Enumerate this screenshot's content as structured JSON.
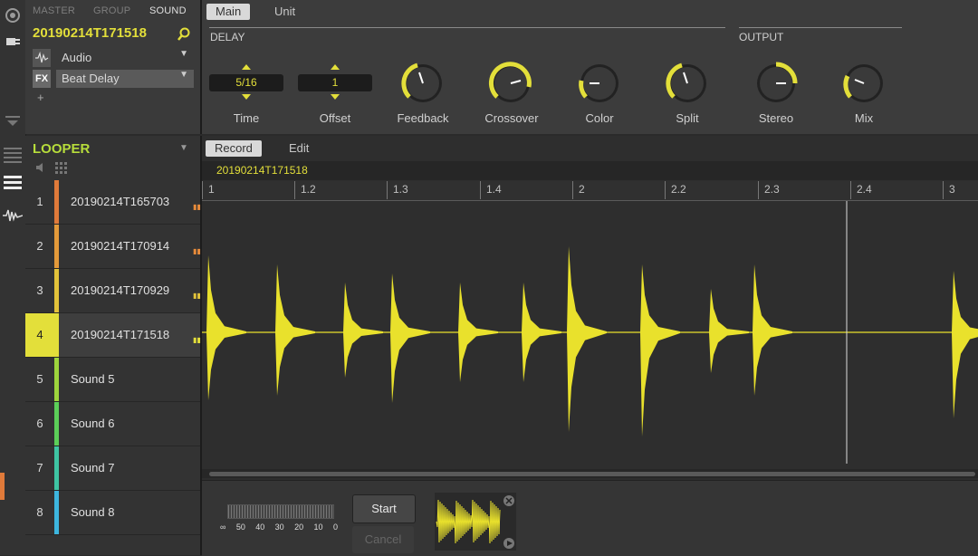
{
  "header_tabs": [
    "MASTER",
    "GROUP",
    "SOUND"
  ],
  "sound_name": "20190214T171518",
  "slots": [
    {
      "icon": "",
      "label": "Audio"
    },
    {
      "icon": "FX",
      "label": "Beat Delay"
    }
  ],
  "add_label": "+",
  "param_tabs": [
    "Main",
    "Unit"
  ],
  "sections": {
    "delay": "DELAY",
    "output": "OUTPUT"
  },
  "params": {
    "time": {
      "label": "Time",
      "value": "5/16"
    },
    "offset": {
      "label": "Offset",
      "value": "1"
    },
    "feedback": {
      "label": "Feedback"
    },
    "crossover": {
      "label": "Crossover"
    },
    "color": {
      "label": "Color"
    },
    "split": {
      "label": "Split"
    },
    "stereo": {
      "label": "Stereo"
    },
    "mix": {
      "label": "Mix"
    }
  },
  "looper": {
    "title": "LOOPER",
    "rows": [
      {
        "num": "1",
        "label": "20190214T165703",
        "color": "#e07a3a"
      },
      {
        "num": "2",
        "label": "20190214T170914",
        "color": "#e49a3a"
      },
      {
        "num": "3",
        "label": "20190214T170929",
        "color": "#e3c33a"
      },
      {
        "num": "4",
        "label": "20190214T171518",
        "color": "#e3df3a"
      },
      {
        "num": "5",
        "label": "Sound 5",
        "color": "#9ed53c"
      },
      {
        "num": "6",
        "label": "Sound 6",
        "color": "#5bcf58"
      },
      {
        "num": "7",
        "label": "Sound 7",
        "color": "#3ec4a3"
      },
      {
        "num": "8",
        "label": "Sound 8",
        "color": "#3db6df"
      }
    ]
  },
  "main_tabs": [
    "Record",
    "Edit"
  ],
  "clip_name": "20190214T171518",
  "ruler": [
    "1",
    "1.2",
    "1.3",
    "1.4",
    "2",
    "2.2",
    "2.3",
    "2.4",
    "3"
  ],
  "meter_scale": [
    "∞",
    "50",
    "40",
    "30",
    "20",
    "10",
    "0"
  ],
  "buttons": {
    "start": "Start",
    "cancel": "Cancel"
  },
  "colors": {
    "accent": "#e3df3a",
    "wave": "#e9e12c"
  }
}
